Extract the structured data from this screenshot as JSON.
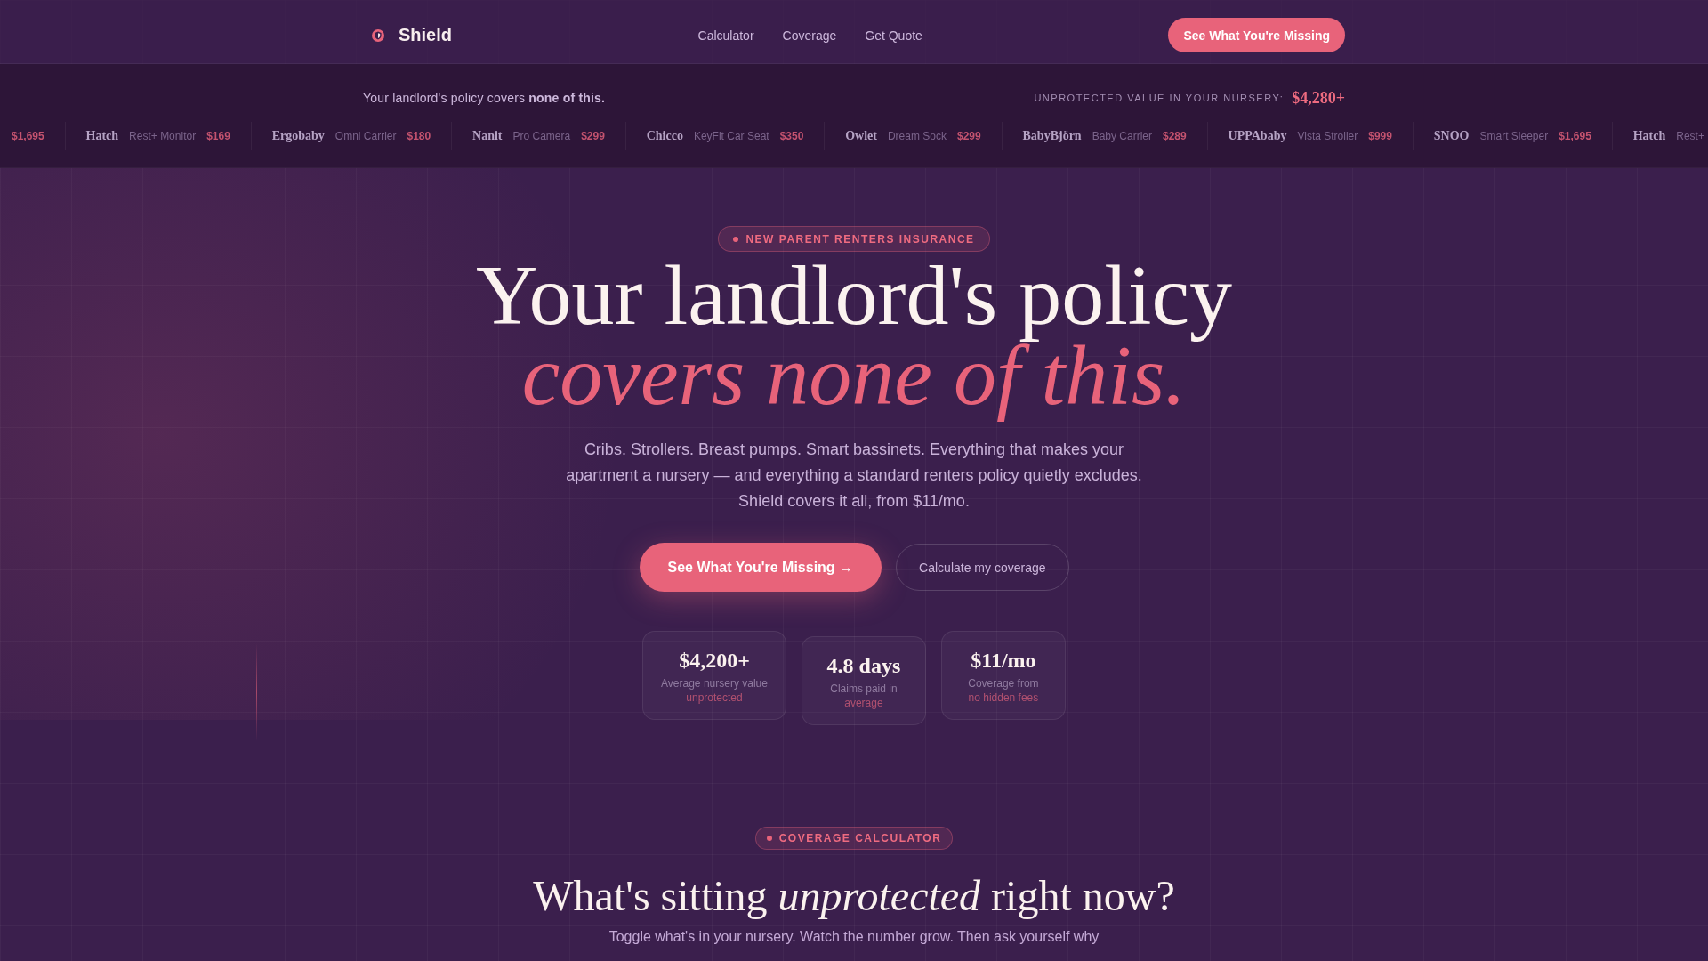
{
  "nav": {
    "brand": "Shield",
    "links": [
      {
        "label": "Calculator"
      },
      {
        "label": "Coverage"
      },
      {
        "label": "Get Quote"
      }
    ],
    "cta": "See What You're Missing"
  },
  "banner": {
    "message": "Your landlord's policy covers **none of this.**",
    "total_label": "UNPROTECTED VALUE IN YOUR NURSERY:",
    "total_value": "$4,280+"
  },
  "ticker": [
    {
      "price": "$1,695"
    },
    {
      "brand": "Hatch",
      "product": "Rest+ Monitor",
      "price": "$169"
    },
    {
      "brand": "Ergobaby",
      "product": "Omni Carrier",
      "price": "$180"
    },
    {
      "brand": "Nanit",
      "product": "Pro Camera",
      "price": "$299"
    },
    {
      "brand": "Chicco",
      "product": "KeyFit Car Seat",
      "price": "$350"
    },
    {
      "brand": "Owlet",
      "product": "Dream Sock",
      "price": "$299"
    },
    {
      "brand": "BabyBjörn",
      "product": "Baby Carrier",
      "price": "$289"
    },
    {
      "brand": "UPPAbaby",
      "product": "Vista Stroller",
      "price": "$999"
    },
    {
      "brand": "SNOO",
      "product": "Smart Sleeper",
      "price": "$1,695"
    },
    {
      "brand": "Hatch",
      "product": "Rest+"
    }
  ],
  "hero": {
    "badge": "NEW PARENT RENTERS INSURANCE",
    "title": "Your landlord's policy",
    "title_emphasis": "covers none of this.",
    "description": "Cribs. Strollers. Breast pumps. Smart bassinets. Everything that makes your apartment a nursery — and everything a standard renters policy quietly excludes. Shield covers it all, from $11/mo.",
    "primary_button": "See What You're Missing →",
    "secondary_button": "Calculate my coverage",
    "stats": [
      {
        "value": "$4,200+",
        "label": "Average nursery value",
        "note": "unprotected"
      },
      {
        "value": "4.8 days",
        "label": "Claims paid in",
        "note": "average"
      },
      {
        "value": "$11/mo",
        "label": "Coverage from",
        "note": "no hidden fees"
      }
    ]
  },
  "calculator": {
    "badge": "COVERAGE CALCULATOR",
    "title": "What's sitting *unprotected* right now?",
    "subtitle": "Toggle what's in your nursery. Watch the number grow. Then ask yourself why"
  }
}
